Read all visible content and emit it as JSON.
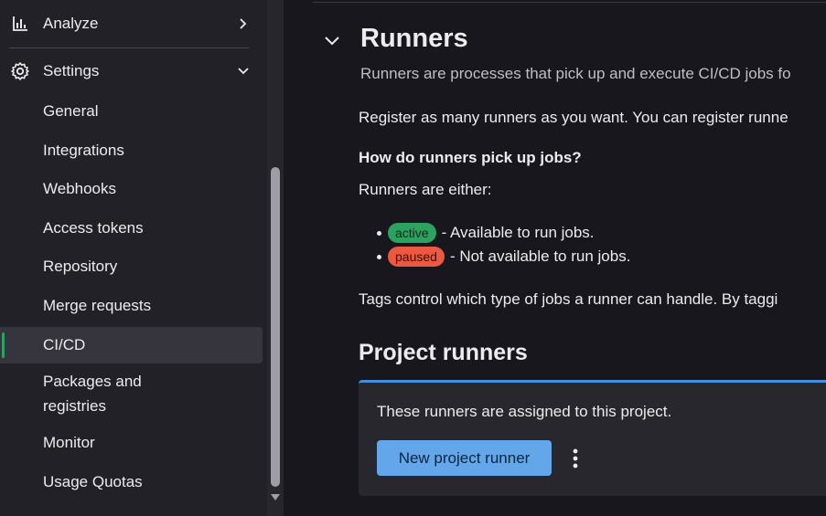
{
  "sidebar": {
    "analyze_label": "Analyze",
    "settings_label": "Settings",
    "items": [
      {
        "label": "General"
      },
      {
        "label": "Integrations"
      },
      {
        "label": "Webhooks"
      },
      {
        "label": "Access tokens"
      },
      {
        "label": "Repository"
      },
      {
        "label": "Merge requests"
      },
      {
        "label": "CI/CD"
      },
      {
        "label": "Packages and"
      },
      {
        "label": "registries"
      },
      {
        "label": "Monitor"
      },
      {
        "label": "Usage Quotas"
      }
    ],
    "active_item": "CI/CD"
  },
  "main": {
    "title": "Runners",
    "description": "Runners are processes that pick up and execute CI/CD jobs fo",
    "register_text": "Register as many runners as you want. You can register runne",
    "question": "How do runners pick up jobs?",
    "either_text": "Runners are either:",
    "bullets": [
      {
        "badge": "active",
        "text": "- Available to run jobs."
      },
      {
        "badge": "paused",
        "text": "- Not available to run jobs."
      }
    ],
    "tags_text": "Tags control which type of jobs a runner can handle. By taggi",
    "project_runners_title": "Project runners",
    "card_text": "These runners are assigned to this project.",
    "new_runner_button": "New project runner"
  },
  "colors": {
    "accent_blue": "#63a6e9",
    "active_green": "#2da160",
    "paused_red": "#ec5941"
  }
}
